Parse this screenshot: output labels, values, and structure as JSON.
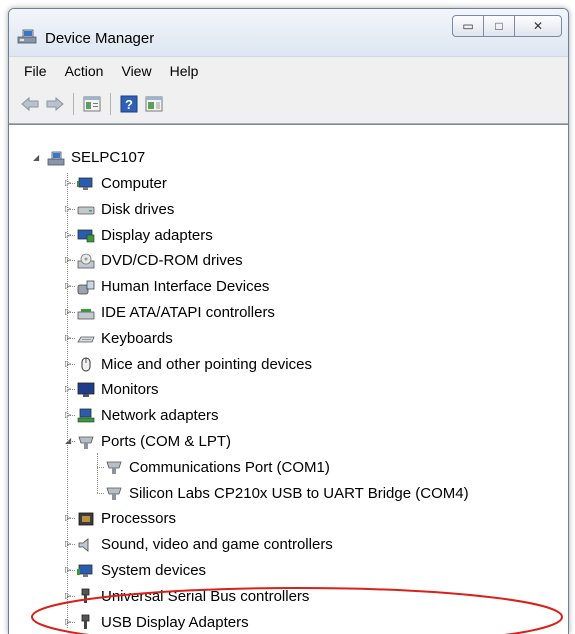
{
  "window": {
    "title": "Device Manager"
  },
  "caption_buttons": {
    "minimize": "▭",
    "maximize": "□",
    "close": "✕"
  },
  "menu": [
    "File",
    "Action",
    "View",
    "Help"
  ],
  "tree": {
    "root": "SELPC107",
    "categories": [
      {
        "label": "Computer",
        "icon": "computer-icon",
        "expanded": false
      },
      {
        "label": "Disk drives",
        "icon": "disk-drive-icon",
        "expanded": false
      },
      {
        "label": "Display adapters",
        "icon": "display-adapter-icon",
        "expanded": false
      },
      {
        "label": "DVD/CD-ROM drives",
        "icon": "dvd-drive-icon",
        "expanded": false
      },
      {
        "label": "Human Interface Devices",
        "icon": "hid-icon",
        "expanded": false
      },
      {
        "label": "IDE ATA/ATAPI controllers",
        "icon": "ide-controller-icon",
        "expanded": false
      },
      {
        "label": "Keyboards",
        "icon": "keyboard-icon",
        "expanded": false
      },
      {
        "label": "Mice and other pointing devices",
        "icon": "mouse-icon",
        "expanded": false
      },
      {
        "label": "Monitors",
        "icon": "monitor-icon",
        "expanded": false
      },
      {
        "label": "Network adapters",
        "icon": "network-adapter-icon",
        "expanded": false
      },
      {
        "label": "Ports (COM & LPT)",
        "icon": "port-icon",
        "expanded": true,
        "children": [
          {
            "label": "Communications Port (COM1)",
            "icon": "port-icon"
          },
          {
            "label": "Silicon Labs CP210x USB to UART Bridge (COM4)",
            "icon": "port-icon"
          }
        ]
      },
      {
        "label": "Processors",
        "icon": "processor-icon",
        "expanded": false
      },
      {
        "label": "Sound, video and game controllers",
        "icon": "sound-icon",
        "expanded": false
      },
      {
        "label": "System devices",
        "icon": "system-devices-icon",
        "expanded": false
      },
      {
        "label": "Universal Serial Bus controllers",
        "icon": "usb-controller-icon",
        "expanded": false
      },
      {
        "label": "USB Display Adapters",
        "icon": "usb-display-icon",
        "expanded": false
      }
    ]
  },
  "colors": {
    "highlight_ellipse": "#d8211b",
    "title_bar": "#dde6f1",
    "tree_background": "#ffffff"
  }
}
